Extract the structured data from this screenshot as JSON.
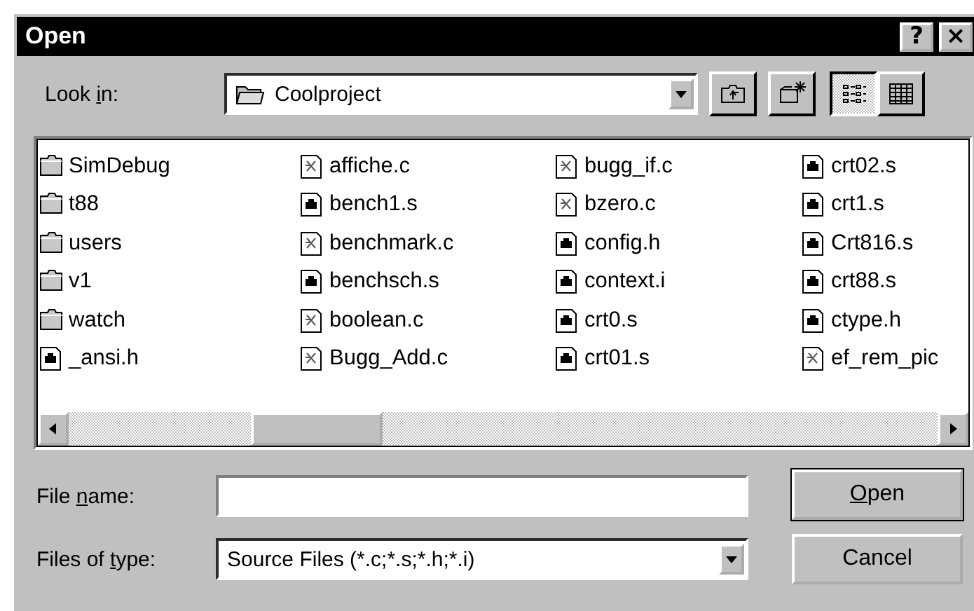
{
  "window": {
    "title": "Open",
    "title_buttons": [
      "?",
      "×"
    ]
  },
  "look_in": {
    "label": {
      "start": "Look ",
      "key": "i",
      "end": "n:"
    },
    "value": "Coolproject"
  },
  "toolbar": [
    {
      "kind": "up"
    },
    {
      "kind": "new_folder"
    },
    {
      "kind": "list",
      "selected": true
    },
    {
      "kind": "details",
      "selected": false
    }
  ],
  "files": [
    {
      "name": "SimDebug",
      "kind": "folder"
    },
    {
      "name": "t88",
      "kind": "folder"
    },
    {
      "name": "users",
      "kind": "folder"
    },
    {
      "name": "v1",
      "kind": "folder"
    },
    {
      "name": "watch",
      "kind": "folder"
    },
    {
      "name": "_ansi.h",
      "kind": "asm"
    },
    {
      "name": "affiche.c",
      "kind": "source"
    },
    {
      "name": "bench1.s",
      "kind": "asm"
    },
    {
      "name": "benchmark.c",
      "kind": "source"
    },
    {
      "name": "benchsch.s",
      "kind": "asm"
    },
    {
      "name": "boolean.c",
      "kind": "source"
    },
    {
      "name": "Bugg_Add.c",
      "kind": "source"
    },
    {
      "name": "bugg_if.c",
      "kind": "source"
    },
    {
      "name": "bzero.c",
      "kind": "source"
    },
    {
      "name": "config.h",
      "kind": "asm"
    },
    {
      "name": "context.i",
      "kind": "asm"
    },
    {
      "name": "crt0.s",
      "kind": "asm"
    },
    {
      "name": "crt01.s",
      "kind": "asm"
    },
    {
      "name": "crt02.s",
      "kind": "asm"
    },
    {
      "name": "crt1.s",
      "kind": "asm"
    },
    {
      "name": "Crt816.s",
      "kind": "asm"
    },
    {
      "name": "crt88.s",
      "kind": "asm"
    },
    {
      "name": "ctype.h",
      "kind": "asm"
    },
    {
      "name": "ef_rem_pic",
      "kind": "source"
    }
  ],
  "file_name": {
    "label": {
      "start": "File ",
      "key": "n",
      "end": "ame:"
    }
  },
  "file_type": {
    "label": {
      "start": "Files of ",
      "key": "t",
      "end": "ype:"
    },
    "value": "Source Files (*.c;*.s;*.h;*.i)"
  },
  "buttons": [
    {
      "label": {
        "key": "O",
        "end": "pen"
      },
      "default": true
    },
    {
      "label": {
        "start": "Cancel"
      },
      "default": false
    }
  ]
}
